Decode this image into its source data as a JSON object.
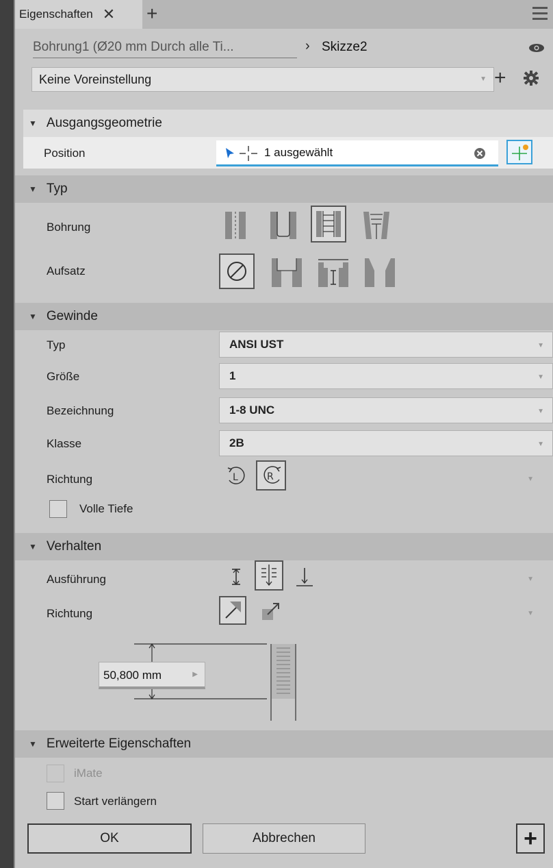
{
  "tab": {
    "title": "Eigenschaften",
    "close_glyph": "✕",
    "add_glyph": "+"
  },
  "breadcrumb": {
    "feature": "Bohrung1 (Ø20 mm Durch alle Ti...",
    "separator": "›",
    "sketch": "Skizze2"
  },
  "preset": {
    "value": "Keine Voreinstellung"
  },
  "sections": {
    "geometry": {
      "title": "Ausgangsgeometrie",
      "position_label": "Position",
      "position_value": "1 ausgewählt"
    },
    "type": {
      "title": "Typ",
      "bohrung_label": "Bohrung",
      "aufsatz_label": "Aufsatz"
    },
    "thread": {
      "title": "Gewinde",
      "typ_label": "Typ",
      "typ_value": "ANSI UST",
      "groesse_label": "Größe",
      "groesse_value": "1",
      "bezeichnung_label": "Bezeichnung",
      "bezeichnung_value": "1-8 UNC",
      "klasse_label": "Klasse",
      "klasse_value": "2B",
      "richtung_label": "Richtung",
      "volle_tiefe_label": "Volle Tiefe"
    },
    "behavior": {
      "title": "Verhalten",
      "ausfuehrung_label": "Ausführung",
      "richtung_label": "Richtung",
      "depth_value": "50,800 mm"
    },
    "advanced": {
      "title": "Erweiterte Eigenschaften",
      "imate_label": "iMate",
      "start_label": "Start verlängern"
    }
  },
  "buttons": {
    "ok": "OK",
    "cancel": "Abbrechen",
    "add": "+"
  },
  "colors": {
    "accent": "#3aa0d8",
    "selection_cursor": "#1a6fd0",
    "green_point": "#2aa84a"
  }
}
